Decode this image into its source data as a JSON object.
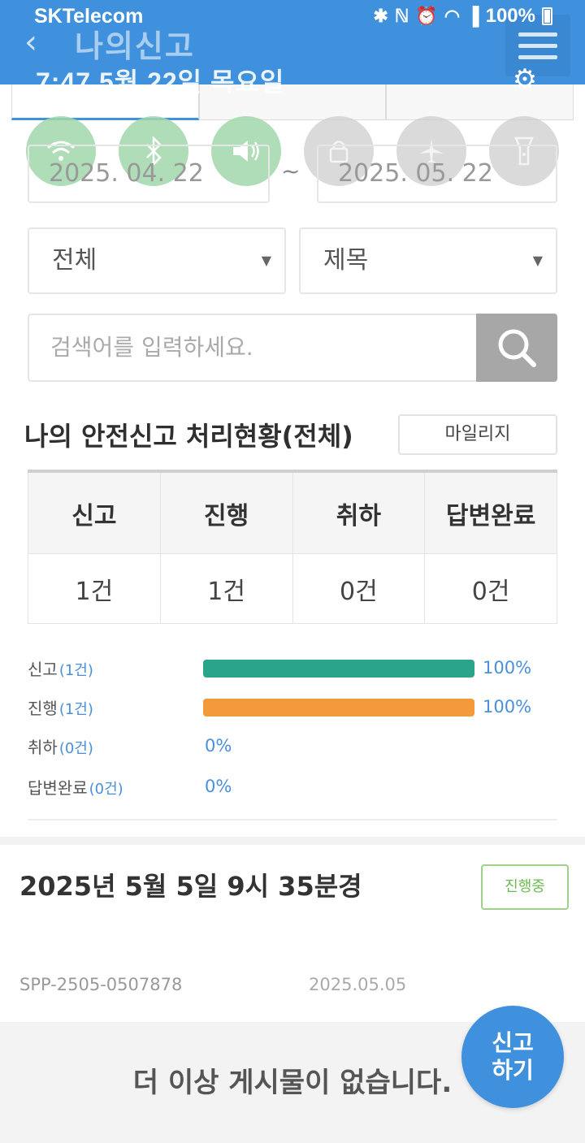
{
  "status_bar": {
    "carrier": "SKTelecom",
    "battery": "100%"
  },
  "shade": {
    "clock": "7:47  5월 22일 목요일",
    "toggles": [
      {
        "icon": "wifi-icon",
        "state": "on"
      },
      {
        "icon": "bluetooth-icon",
        "state": "on"
      },
      {
        "icon": "sound-icon",
        "state": "on"
      },
      {
        "icon": "rotation-lock-icon",
        "state": "off"
      },
      {
        "icon": "airplane-icon",
        "state": "off"
      },
      {
        "icon": "flashlight-icon",
        "state": "off"
      }
    ]
  },
  "header": {
    "title": "나의신고"
  },
  "filters": {
    "date_start": "2025. 04. 22",
    "date_end": "2025. 05. 22",
    "tilde": "~",
    "range_select": "전체",
    "field_select": "제목",
    "search_placeholder": "검색어를 입력하세요."
  },
  "summary": {
    "title": "나의 안전신고 처리현황(전체)",
    "mypage_button": "마일리지",
    "headers": [
      "신고",
      "진행",
      "취하",
      "답변완료"
    ],
    "values": [
      "1건",
      "1건",
      "0건",
      "0건"
    ]
  },
  "chart_data": {
    "type": "bar",
    "categories": [
      "신고",
      "진행",
      "취하",
      "답변완료"
    ],
    "counts": [
      "(1건)",
      "(1건)",
      "(0건)",
      "(0건)"
    ],
    "values": [
      100,
      100,
      0,
      0
    ],
    "labels": [
      "100%",
      "100%",
      "0%",
      "0%"
    ],
    "colors": [
      "#2aa58a",
      "#f39a3b",
      "#2aa58a",
      "#2aa58a"
    ],
    "ylim": [
      0,
      100
    ]
  },
  "report": {
    "title": "2025년 5월 5일 9시 35분경",
    "status": "진행중",
    "number": "SPP-2505-0507878",
    "date": "2025.05.05"
  },
  "footer": {
    "no_more": "더 이상 게시물이 없습니다.",
    "fab_line1": "신고",
    "fab_line2": "하기"
  }
}
